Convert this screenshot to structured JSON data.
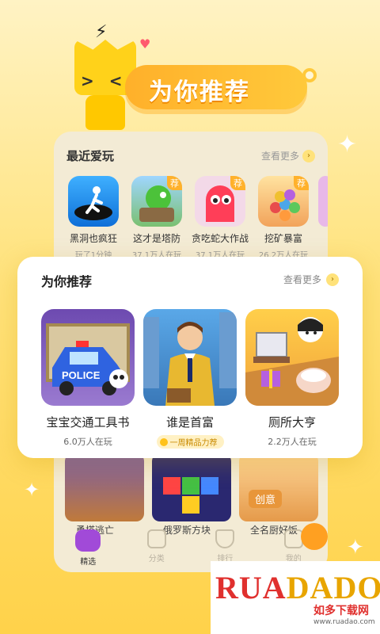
{
  "colors": {
    "accent": "#ffb02a",
    "tab_active": "#a14ad8",
    "badge": "#ffb12b"
  },
  "banner": {
    "title": "为你推荐"
  },
  "recent": {
    "title": "最近爱玩",
    "more": "查看更多",
    "items": [
      {
        "name": "黑洞也疯狂",
        "sub": "玩了1分钟",
        "tag": ""
      },
      {
        "name": "这才是塔防",
        "sub": "37.1万人在玩",
        "tag": "荐"
      },
      {
        "name": "贪吃蛇大作战",
        "sub": "37.1万人在玩",
        "tag": "荐"
      },
      {
        "name": "挖矿暴富",
        "sub": "26.2万人在玩",
        "tag": "荐"
      }
    ]
  },
  "recommend": {
    "title": "为你推荐",
    "more": "查看更多",
    "games": [
      {
        "name": "宝宝交通工具书",
        "sub": "6.0万人在玩",
        "icon": "police-car"
      },
      {
        "name": "谁是首富",
        "sub": "一周精品力荐",
        "icon": "rich-man"
      },
      {
        "name": "厕所大亨",
        "sub": "2.2万人在玩",
        "icon": "toilet-tycoon"
      }
    ]
  },
  "back_games": [
    {
      "name": "勇塔逃亡"
    },
    {
      "name": "俄罗斯方块"
    },
    {
      "name": "全名厨好饭",
      "tag": "创意"
    }
  ],
  "tabs": [
    {
      "label": "精选",
      "icon": "game-controller-icon",
      "active": true
    },
    {
      "label": "分类",
      "icon": "folder-icon",
      "active": false
    },
    {
      "label": "排行",
      "icon": "trophy-icon",
      "active": false
    },
    {
      "label": "我的",
      "icon": "profile-icon",
      "active": false
    }
  ],
  "watermark": {
    "logo_left": "RUA",
    "logo_right": "DADO",
    "sub": "如多下载网",
    "url": "www.ruadao.com"
  }
}
